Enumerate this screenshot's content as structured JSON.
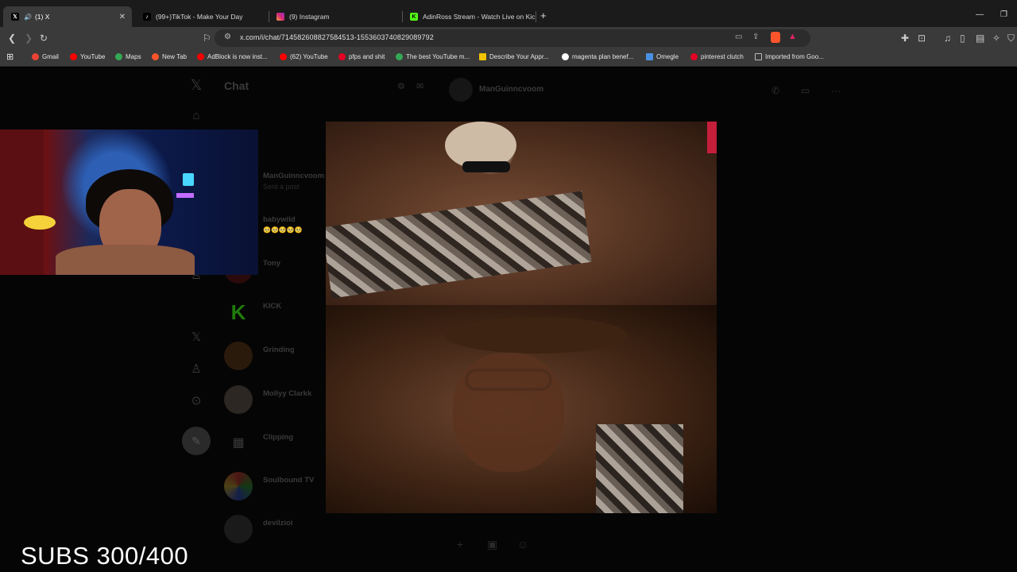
{
  "browser": {
    "tabs": [
      {
        "label": "(1) X",
        "favicon": "x-logo-icon",
        "active": true
      },
      {
        "label": "(99+)TikTok - Make Your Day",
        "favicon": "tiktok-icon",
        "active": false
      },
      {
        "label": "(9) Instagram",
        "favicon": "instagram-icon",
        "active": false
      },
      {
        "label": "AdinRoss Stream - Watch Live on Kic",
        "favicon": "kick-icon",
        "active": false
      }
    ],
    "new_tab_glyph": "+",
    "url": "x.com/i/chat/714582608827584513-1553603740829089792",
    "bookmarks": [
      {
        "label": "Gmail",
        "color": "#ea4335"
      },
      {
        "label": "YouTube",
        "color": "#ff0000"
      },
      {
        "label": "Maps",
        "color": "#34a853"
      },
      {
        "label": "New Tab",
        "color": "#fb542b"
      },
      {
        "label": "AdBlock is now inst...",
        "color": "#f40000"
      },
      {
        "label": "(62) YouTube",
        "color": "#ff0000"
      },
      {
        "label": "pfps and shit",
        "color": "#e60023"
      },
      {
        "label": "The best YouTube m...",
        "color": "#34a853"
      },
      {
        "label": "Describe Your Appr...",
        "color": "#f2c200"
      },
      {
        "label": "magenta plan benef...",
        "color": "#ffffff"
      },
      {
        "label": "Omegle",
        "color": "#4a90e2"
      },
      {
        "label": "pinterest clutch",
        "color": "#e60023"
      },
      {
        "label": "Imported from Goo...",
        "color": "#9a9a9a"
      }
    ]
  },
  "x_app": {
    "chat_title": "Chat",
    "conversations": [
      {
        "name": "ManGuinncvoom",
        "preview": "Sent a post"
      },
      {
        "name": "babywild",
        "preview": "🥺🥺🥺🥺🥺"
      },
      {
        "name": "Tony",
        "preview": ""
      },
      {
        "name": "KICK",
        "preview": ""
      },
      {
        "name": "Grinding",
        "preview": ""
      },
      {
        "name": "Mollyy Clarkk",
        "preview": ""
      },
      {
        "name": "Clipping",
        "preview": ""
      },
      {
        "name": "Soulbound TV",
        "preview": ""
      },
      {
        "name": "devilzioi",
        "preview": ""
      }
    ],
    "header_name": "ManGuinncvoom"
  },
  "overlay": {
    "subs_text": "SUBS 300/400"
  }
}
